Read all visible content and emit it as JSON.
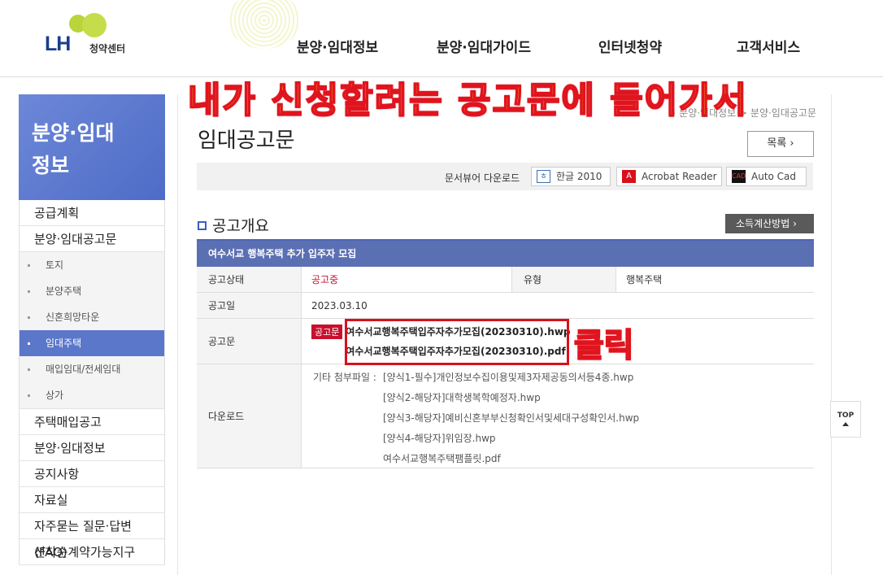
{
  "header": {
    "logo_text": "LH",
    "logo_sub": "청약센터",
    "nav": [
      "분양·임대정보",
      "분양·임대가이드",
      "인터넷청약",
      "고객서비스"
    ]
  },
  "sidebar": {
    "title_line1": "분양·임대",
    "title_line2": "정보",
    "items": [
      {
        "label": "공급계획"
      },
      {
        "label": "분양·임대공고문"
      }
    ],
    "sub_items": [
      "토지",
      "분양주택",
      "신혼희망타운",
      "임대주택",
      "매입임대/전세임대",
      "상가"
    ],
    "more_items": [
      "주택매입공고",
      "분양·임대정보",
      "공지사항",
      "자료실",
      "자주묻는 질문·답변(FAQ)",
      "선착순계약가능지구"
    ]
  },
  "content": {
    "breadcrumb": "> 분양·임대정보 > 분양·임대공고문",
    "page_title": "임대공고문",
    "list_button": "목록",
    "viewer_label": "문서뷰어 다운로드",
    "viewers": [
      "한글 2010",
      "Acrobat Reader",
      "Auto Cad"
    ],
    "section_title": "공고개요",
    "income_button": "소득계산방법",
    "table": {
      "title": "여수서교 행복주택 추가 입주자 모집",
      "status_label": "공고상태",
      "status_value": "공고중",
      "type_label": "유형",
      "type_value": "행복주택",
      "date_label": "공고일",
      "date_value": "2023.03.10",
      "notice_label": "공고문",
      "notice_badge": "공고문",
      "notice_files": [
        "여수서교행복주택입주자추가모집(20230310).hwp",
        "여수서교행복주택입주자추가모집(20230310).pdf"
      ],
      "download_label": "다운로드",
      "etc_label": "기타 첨부파일 :",
      "etc_files": [
        "[양식1-필수]개인정보수집이용및제3자제공동의서등4종.hwp",
        "[양식2-해당자]대학생복학예정자.hwp",
        "[양식3-해당자]예비신혼부부신청확인서및세대구성확인서.hwp",
        "[양식4-해당자]위임장.hwp",
        "여수서교행복주택팸플릿.pdf"
      ]
    }
  },
  "annotations": {
    "overlay": "내가 신청할려는 공고문에 들어가서",
    "click": "클릭"
  },
  "top_button": "TOP",
  "colors": {
    "brand_blue": "#5b77c9",
    "table_header": "#5b6fb3",
    "status_red": "#c8102e",
    "annotation_yellow": "#f2e91f",
    "annotation_red": "#e0141e"
  }
}
